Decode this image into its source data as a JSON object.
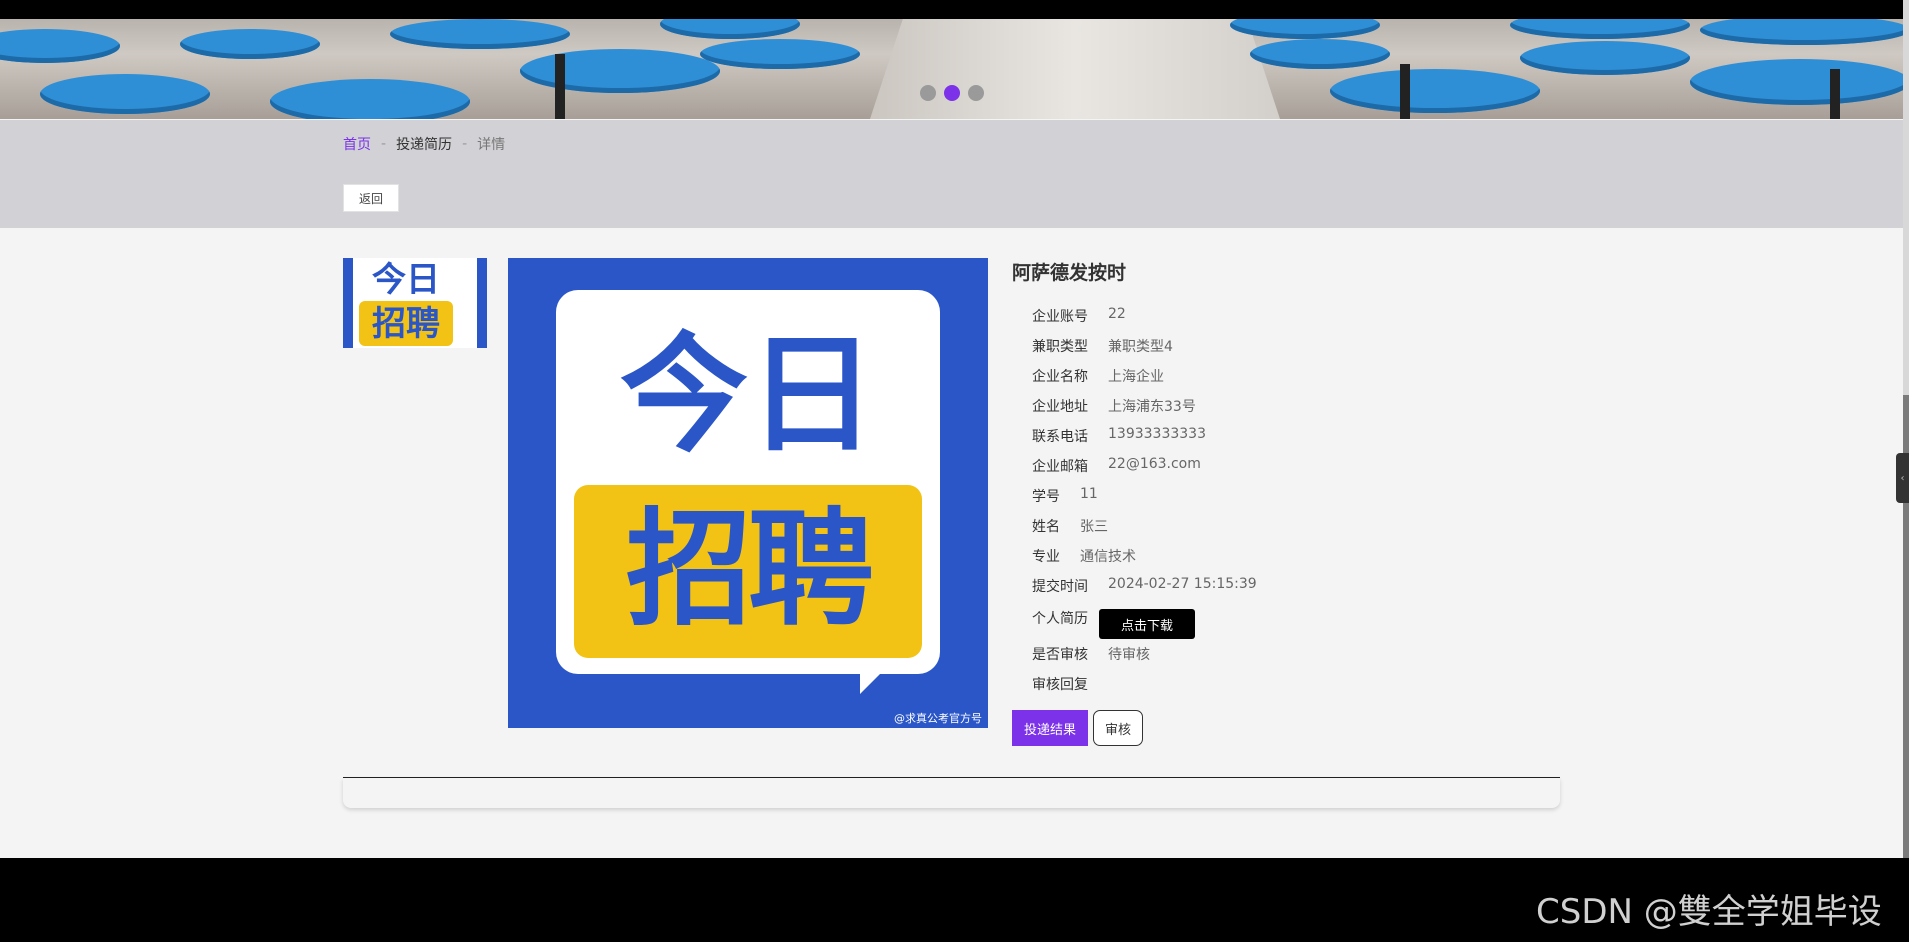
{
  "banner": {
    "dots": 3,
    "active_dot": 1
  },
  "breadcrumb": {
    "home": "首页",
    "sep": "-",
    "section": "投递简历",
    "current": "详情"
  },
  "back_label": "返回",
  "logo": {
    "line1": "今日",
    "line2": "招聘"
  },
  "poster": {
    "line1": "今日",
    "line2": "招聘",
    "watermark": "@求真公考官方号"
  },
  "detail": {
    "title": "阿萨德发按时",
    "fields": [
      {
        "label": "企业账号",
        "value": "22"
      },
      {
        "label": "兼职类型",
        "value": "兼职类型4"
      },
      {
        "label": "企业名称",
        "value": "上海企业"
      },
      {
        "label": "企业地址",
        "value": "上海浦东33号"
      },
      {
        "label": "联系电话",
        "value": "13933333333"
      },
      {
        "label": "企业邮箱",
        "value": "22@163.com"
      },
      {
        "label": "学号",
        "value": "11"
      },
      {
        "label": "姓名",
        "value": "张三"
      },
      {
        "label": "专业",
        "value": "通信技术"
      },
      {
        "label": "提交时间",
        "value": "2024-02-27 15:15:39"
      },
      {
        "label": "个人简历",
        "value": ""
      },
      {
        "label": "是否审核",
        "value": "待审核"
      },
      {
        "label": "审核回复",
        "value": ""
      }
    ],
    "download_label": "点击下载",
    "result_label": "投递结果",
    "audit_label": "审核"
  },
  "side_tab_icon": "‹",
  "watermark": "CSDN @雙全学姐毕设",
  "colors": {
    "accent": "#7b32e8",
    "poster_blue": "#2a56c8",
    "poster_yellow": "#f2c314"
  }
}
